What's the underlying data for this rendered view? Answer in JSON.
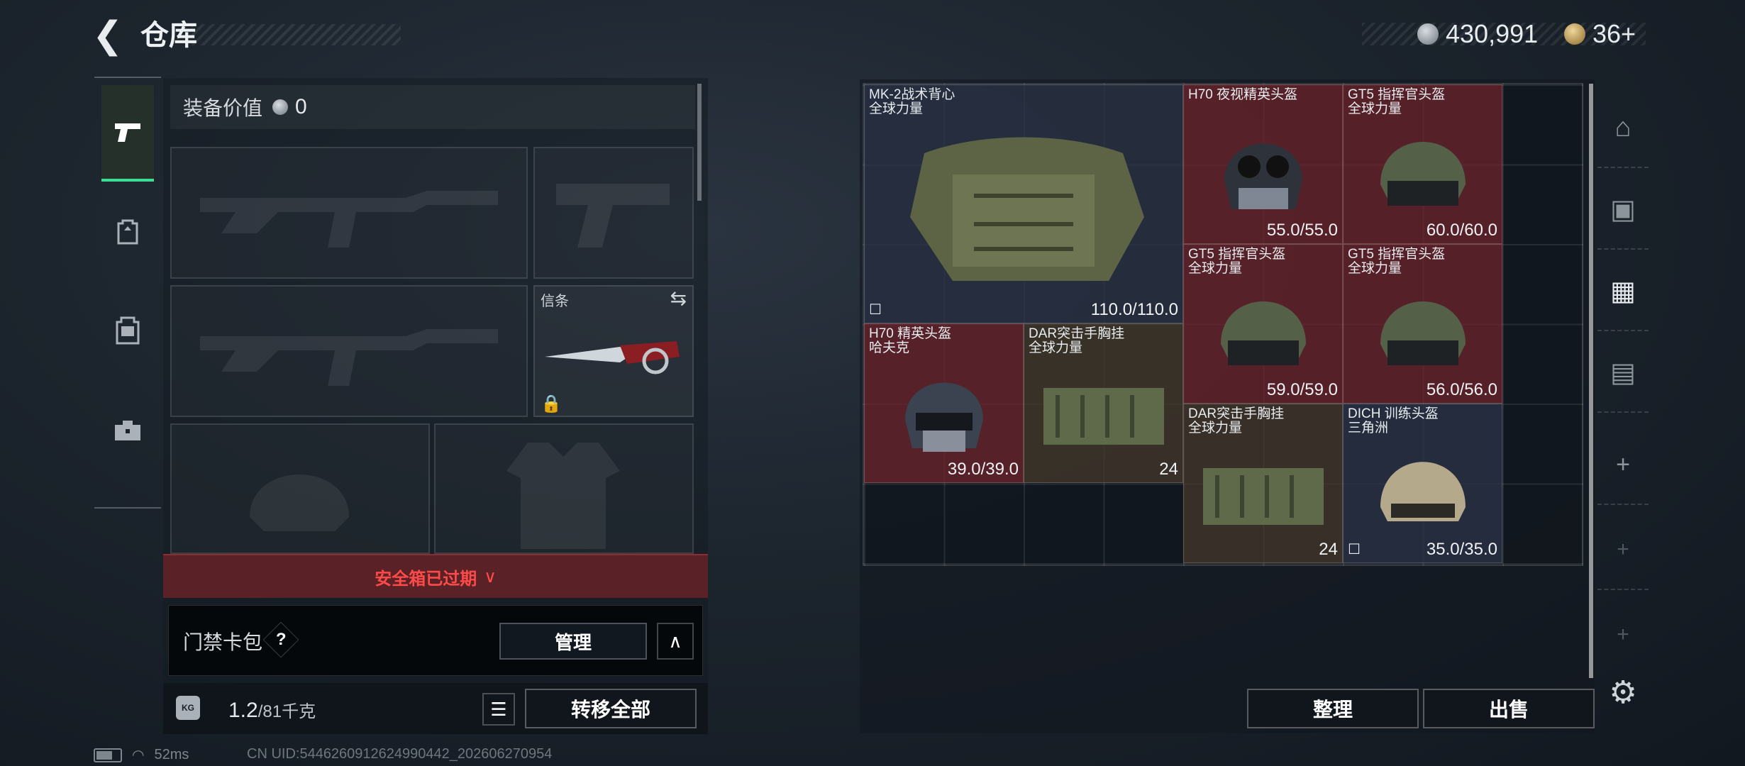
{
  "header": {
    "title": "仓库",
    "silver": "430,991",
    "gold": "36+"
  },
  "tabs": [
    {
      "icon": "pistol-icon"
    },
    {
      "icon": "backpack-icon"
    },
    {
      "icon": "vest-icon"
    },
    {
      "icon": "toolbox-icon"
    }
  ],
  "equipment": {
    "value_label": "装备价值",
    "value": "0",
    "knife_label": "信条"
  },
  "safebox_warning": "安全箱已过期",
  "access_card": {
    "label": "门禁卡包",
    "help": "?",
    "manage": "管理"
  },
  "footer": {
    "weight": "1.2",
    "capacity": "/81千克",
    "transfer_all": "转移全部"
  },
  "storage": {
    "items": [
      {
        "name": "MK-2战术背心",
        "sub": "全球力量",
        "value": "110.0/110.0"
      },
      {
        "name": "H70 夜视精英头盔",
        "sub": "",
        "value": "55.0/55.0"
      },
      {
        "name": "GT5 指挥官头盔",
        "sub": "全球力量",
        "value": "60.0/60.0"
      },
      {
        "name": "GT5 指挥官头盔",
        "sub": "全球力量",
        "value": "59.0/59.0"
      },
      {
        "name": "GT5 指挥官头盔",
        "sub": "全球力量",
        "value": "56.0/56.0"
      },
      {
        "name": "H70 精英头盔",
        "sub": "哈夫克",
        "value": "39.0/39.0"
      },
      {
        "name": "DAR突击手胸挂",
        "sub": "全球力量",
        "value": "24"
      },
      {
        "name": "DAR突击手胸挂",
        "sub": "全球力量",
        "value": "24"
      },
      {
        "name": "DICH 训练头盔",
        "sub": "三角洲",
        "value": "35.0/35.0"
      }
    ],
    "sort": "整理",
    "sell": "出售"
  },
  "right_rail": [
    "helmet-slot-icon",
    "vest-slot-icon",
    "chest-rig-slot-icon",
    "backpack-slot-icon",
    "+",
    "+",
    "+"
  ],
  "status_bar": {
    "ping": "52ms",
    "uid": "CN UID:5446260912624990442_202606270954"
  },
  "colors": {
    "accent_green": "#3ddc97",
    "warning_red": "#ff4a4a"
  }
}
